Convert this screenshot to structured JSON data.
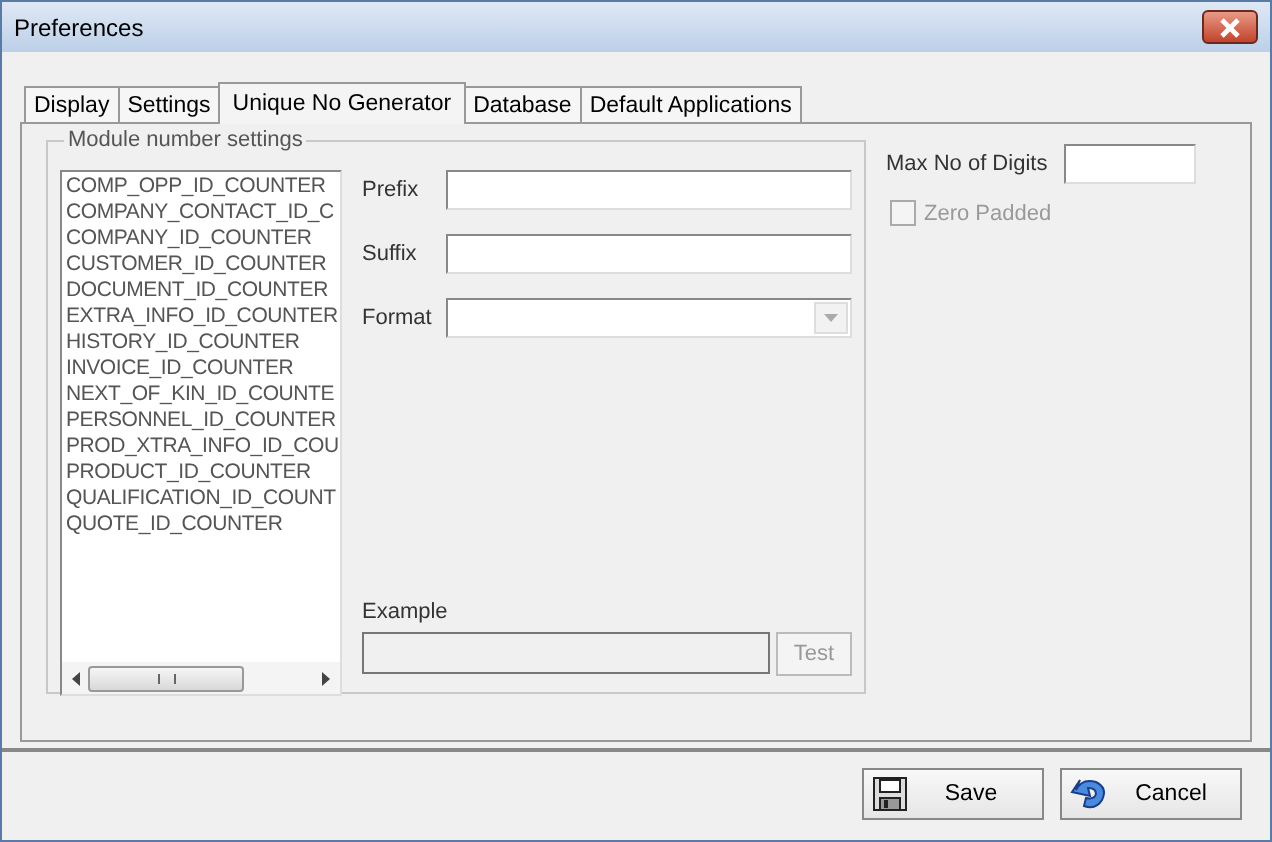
{
  "window": {
    "title": "Preferences"
  },
  "tabs": [
    {
      "label": "Display",
      "selected": false
    },
    {
      "label": "Settings",
      "selected": false
    },
    {
      "label": "Unique No Generator",
      "selected": true
    },
    {
      "label": "Database",
      "selected": false
    },
    {
      "label": "Default Applications",
      "selected": false
    }
  ],
  "module_group": {
    "title": "Module number settings",
    "modules": [
      "COMP_OPP_ID_COUNTER",
      "COMPANY_CONTACT_ID_C",
      "COMPANY_ID_COUNTER",
      "CUSTOMER_ID_COUNTER",
      "DOCUMENT_ID_COUNTER",
      "EXTRA_INFO_ID_COUNTER",
      "HISTORY_ID_COUNTER",
      "INVOICE_ID_COUNTER",
      "NEXT_OF_KIN_ID_COUNTE",
      "PERSONNEL_ID_COUNTER",
      "PROD_XTRA_INFO_ID_COU",
      "PRODUCT_ID_COUNTER",
      "QUALIFICATION_ID_COUNT",
      "QUOTE_ID_COUNTER"
    ],
    "fields": [
      {
        "label": "Prefix",
        "kind": "text"
      },
      {
        "label": "Suffix",
        "kind": "text"
      },
      {
        "label": "Format",
        "kind": "dropdown"
      }
    ],
    "example": {
      "label": "Example"
    },
    "test_button": {
      "label": "Test",
      "disabled": true
    }
  },
  "max_digits": {
    "label": "Max No of Digits"
  },
  "zero_padded": {
    "label": "Zero Padded",
    "checked": false,
    "disabled": true
  },
  "buttons": [
    {
      "label": "Save",
      "kind": "save"
    },
    {
      "label": "Cancel",
      "kind": "cancel"
    }
  ]
}
